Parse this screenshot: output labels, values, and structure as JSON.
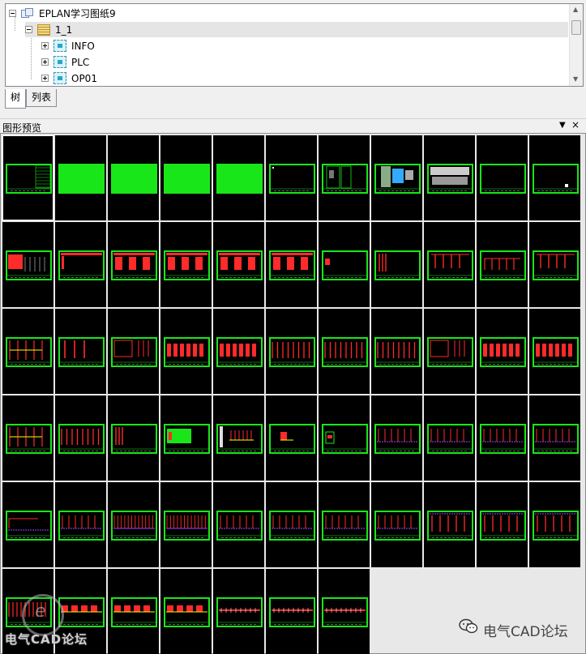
{
  "tree": {
    "items": [
      {
        "label": "EPLAN学习图纸9",
        "level": 0,
        "icon": "project-icon",
        "expander": "minus"
      },
      {
        "label": "1_1",
        "level": 1,
        "icon": "page-folder-icon",
        "expander": "minus",
        "selected": true
      },
      {
        "label": "INFO",
        "level": 2,
        "icon": "plc-structure-icon",
        "expander": "plus"
      },
      {
        "label": "PLC",
        "level": 2,
        "icon": "plc-structure-icon",
        "expander": "plus"
      },
      {
        "label": "OP01",
        "level": 2,
        "icon": "plc-structure-icon",
        "expander": "plus"
      }
    ]
  },
  "tabs": [
    {
      "label": "树",
      "active": true
    },
    {
      "label": "列表",
      "active": false
    }
  ],
  "preview": {
    "title": "图形预览",
    "pin_icon": "pin-icon",
    "close_icon": "close-icon"
  },
  "thumbnails": {
    "rows": [
      [
        "title",
        "solid",
        "solid",
        "solid",
        "solid",
        "blank-mark",
        "cabinet",
        "layout-dense",
        "layout-wide",
        "blank",
        "blank-dot"
      ],
      [
        "table-red",
        "bar-top",
        "circuit-3",
        "circuit-3",
        "circuit-3",
        "circuit-3",
        "small-red",
        "small-red-col",
        "vert-lines",
        "vert-lines-2",
        "vert-lines"
      ],
      [
        "ladder",
        "ladder-2",
        "ladder-3",
        "circuit-dense",
        "circuit-dense",
        "bus-lines",
        "bus-lines",
        "bus-lines",
        "ladder-3",
        "circuit-dense",
        "circuit-dense"
      ],
      [
        "ladder",
        "bus-lines",
        "small-red-col",
        "green-module",
        "terminal",
        "small-symbol",
        "small-box",
        "purple-bus",
        "purple-bus",
        "purple-bus",
        "purple-bus"
      ],
      [
        "purple-step",
        "purple-bus",
        "purple-dense",
        "purple-dense",
        "purple-bus",
        "purple-bus",
        "purple-bus",
        "purple-bus",
        "purple-top",
        "purple-top",
        "purple-top"
      ],
      [
        "red-dense",
        "red-bars",
        "red-bars",
        "red-bars",
        "red-strip",
        "red-strip",
        "red-strip"
      ]
    ]
  },
  "watermark": {
    "logo_letter": "e",
    "left_text": "电气CAD论坛",
    "right_text": "电气CAD论坛",
    "wechat_icon": "wechat-icon"
  },
  "colors": {
    "frame": "#19e619",
    "drawing": "#ff2a2a",
    "bus": "#a040ff",
    "tile_bg": "#000000"
  }
}
